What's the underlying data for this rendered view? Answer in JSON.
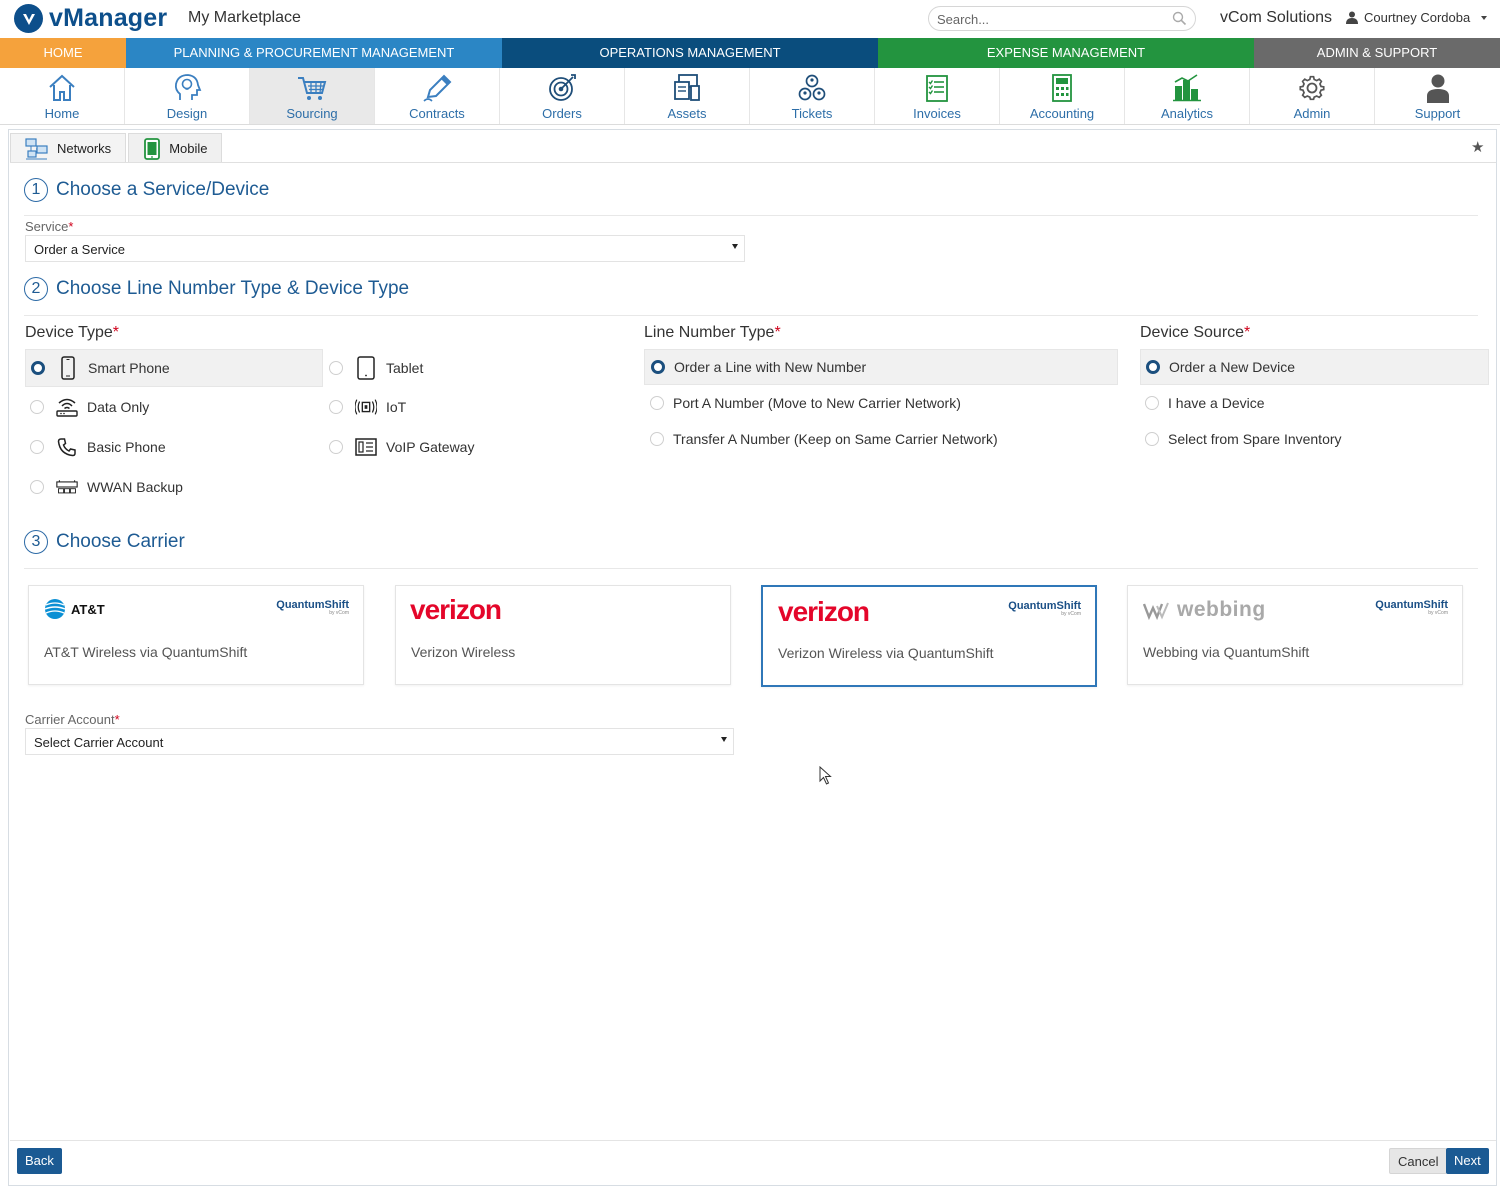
{
  "header": {
    "app_name": "vManager",
    "marketplace_title": "My Marketplace",
    "search_placeholder": "Search...",
    "company": "vCom Solutions",
    "user_name": "Courtney Cordoba"
  },
  "categories": [
    {
      "label": "HOME",
      "color": "#f5a23c"
    },
    {
      "label": "PLANNING & PROCUREMENT MANAGEMENT",
      "color": "#2b86c5"
    },
    {
      "label": "OPERATIONS MANAGEMENT",
      "color": "#0a4d7d"
    },
    {
      "label": "EXPENSE MANAGEMENT",
      "color": "#23943f"
    },
    {
      "label": "ADMIN & SUPPORT",
      "color": "#6a6a6a"
    }
  ],
  "modules": [
    {
      "label": "Home",
      "icon": "home-icon"
    },
    {
      "label": "Design",
      "icon": "lightbulb-head-icon"
    },
    {
      "label": "Sourcing",
      "icon": "cart-icon",
      "active": true
    },
    {
      "label": "Contracts",
      "icon": "pen-icon"
    },
    {
      "label": "Orders",
      "icon": "target-icon"
    },
    {
      "label": "Assets",
      "icon": "devices-icon"
    },
    {
      "label": "Tickets",
      "icon": "people-network-icon"
    },
    {
      "label": "Invoices",
      "icon": "invoice-icon"
    },
    {
      "label": "Accounting",
      "icon": "calculator-icon"
    },
    {
      "label": "Analytics",
      "icon": "buildings-chart-icon"
    },
    {
      "label": "Admin",
      "icon": "gear-icon"
    },
    {
      "label": "Support",
      "icon": "person-icon"
    }
  ],
  "subtabs": [
    {
      "label": "Networks",
      "icon": "network-computers-icon"
    },
    {
      "label": "Mobile",
      "icon": "mobile-phone-icon",
      "active": true
    }
  ],
  "step1": {
    "number": "1",
    "title": "Choose a Service/Device",
    "service_label": "Service",
    "service_value": "Order a Service"
  },
  "step2": {
    "number": "2",
    "title": "Choose Line Number Type & Device Type",
    "device_type_title": "Device Type",
    "device_types": [
      {
        "label": "Smart Phone",
        "icon": "smartphone-icon",
        "selected": true
      },
      {
        "label": "Tablet",
        "icon": "tablet-icon"
      },
      {
        "label": "Data Only",
        "icon": "wifi-router-icon"
      },
      {
        "label": "IoT",
        "icon": "iot-sensor-icon"
      },
      {
        "label": "Basic Phone",
        "icon": "handset-icon"
      },
      {
        "label": "VoIP Gateway",
        "icon": "voip-gateway-icon"
      },
      {
        "label": "WWAN Backup",
        "icon": "wwan-router-icon"
      }
    ],
    "line_type_title": "Line Number Type",
    "line_types": [
      {
        "label": "Order a Line with New Number",
        "selected": true
      },
      {
        "label": "Port A Number (Move to New Carrier Network)"
      },
      {
        "label": "Transfer A Number (Keep on Same Carrier Network)"
      }
    ],
    "device_source_title": "Device Source",
    "device_sources": [
      {
        "label": "Order a New Device",
        "selected": true
      },
      {
        "label": "I have a Device"
      },
      {
        "label": "Select from Spare Inventory"
      }
    ]
  },
  "step3": {
    "number": "3",
    "title": "Choose Carrier",
    "carriers": [
      {
        "name": "AT&T Wireless via QuantumShift",
        "logo": "AT&T",
        "badge": "QuantumShift"
      },
      {
        "name": "Verizon Wireless",
        "logo": "verizon"
      },
      {
        "name": "Verizon Wireless via QuantumShift",
        "logo": "verizon",
        "badge": "QuantumShift",
        "selected": true
      },
      {
        "name": "Webbing via QuantumShift",
        "logo": "webbing",
        "badge": "QuantumShift"
      }
    ],
    "carrier_account_label": "Carrier Account",
    "carrier_account_value": "Select Carrier Account"
  },
  "footer": {
    "back_label": "Back",
    "cancel_label": "Cancel",
    "next_label": "Next"
  },
  "colors": {
    "brand": "#0d4f8b",
    "accent": "#1b5a93",
    "required": "#d0021b",
    "verizon_red": "#e4062a"
  }
}
